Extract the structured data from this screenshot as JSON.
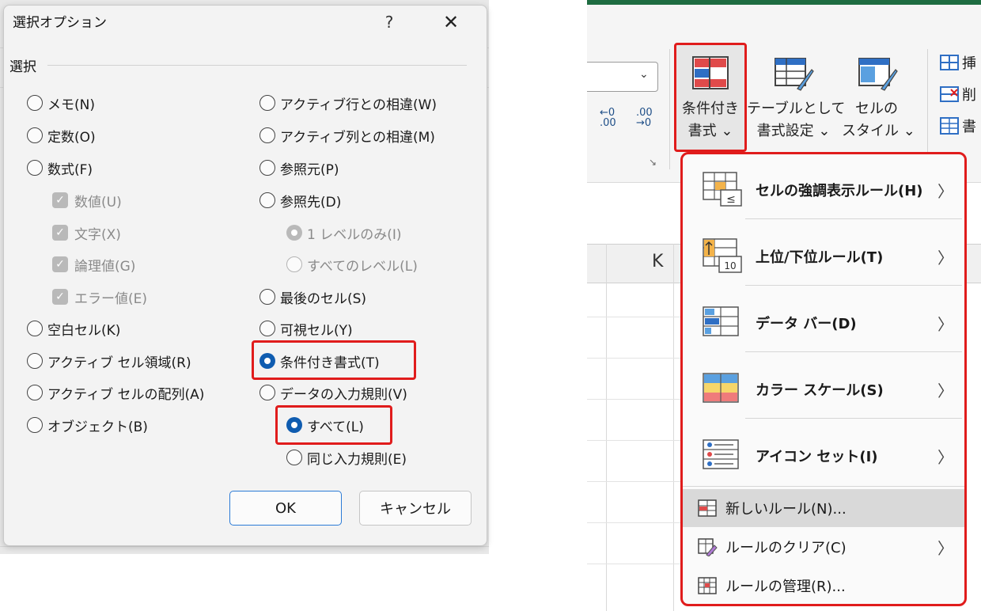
{
  "dialog": {
    "title": "選択オプション",
    "help": "?",
    "close": "✕",
    "group_label": "選択",
    "left_options": [
      {
        "label": "メモ(N)",
        "state": "off"
      },
      {
        "label": "定数(O)",
        "state": "off"
      },
      {
        "label": "数式(F)",
        "state": "off"
      },
      {
        "label": "数値(U)",
        "state": "disabled-checked"
      },
      {
        "label": "文字(X)",
        "state": "disabled-checked"
      },
      {
        "label": "論理値(G)",
        "state": "disabled-checked"
      },
      {
        "label": "エラー値(E)",
        "state": "disabled-checked"
      },
      {
        "label": "空白セル(K)",
        "state": "off"
      },
      {
        "label": "アクティブ セル領域(R)",
        "state": "off"
      },
      {
        "label": "アクティブ セルの配列(A)",
        "state": "off"
      },
      {
        "label": "オブジェクト(B)",
        "state": "off"
      }
    ],
    "right_options": [
      {
        "label": "アクティブ行との相違(W)",
        "state": "off"
      },
      {
        "label": "アクティブ列との相違(M)",
        "state": "off"
      },
      {
        "label": "参照元(P)",
        "state": "off"
      },
      {
        "label": "参照先(D)",
        "state": "off"
      },
      {
        "label": "1 レベルのみ(I)",
        "state": "disabled-selected"
      },
      {
        "label": "すべてのレベル(L)",
        "state": "disabled"
      },
      {
        "label": "最後のセル(S)",
        "state": "off"
      },
      {
        "label": "可視セル(Y)",
        "state": "off"
      },
      {
        "label": "条件付き書式(T)",
        "state": "selected"
      },
      {
        "label": "データの入力規則(V)",
        "state": "off"
      },
      {
        "label": "すべて(L)",
        "state": "selected"
      },
      {
        "label": "同じ入力規則(E)",
        "state": "off"
      }
    ],
    "ok_label": "OK",
    "cancel_label": "キャンセル"
  },
  "ribbon": {
    "combo_arrow": "⌄",
    "launcher": "↘",
    "conditional_format": {
      "line1": "条件付き",
      "line2": "書式 ⌄"
    },
    "table_format": {
      "line1": "テーブルとして",
      "line2": "書式設定 ⌄"
    },
    "cell_style": {
      "line1": "セルの",
      "line2": "スタイル ⌄"
    },
    "insert_label": "挿",
    "delete_label": "削",
    "format_label": "書",
    "column_header": "K"
  },
  "menu": {
    "items": [
      {
        "label": "セルの強調表示ルール(H)",
        "icon": "highlight-rules-icon"
      },
      {
        "label": "上位/下位ルール(T)",
        "icon": "top-bottom-rules-icon"
      },
      {
        "label": "データ バー(D)",
        "icon": "data-bars-icon"
      },
      {
        "label": "カラー スケール(S)",
        "icon": "color-scales-icon"
      },
      {
        "label": "アイコン セット(I)",
        "icon": "icon-sets-icon"
      }
    ],
    "small_items": [
      {
        "label": "新しいルール(N)...",
        "icon": "new-rule-icon",
        "has_submenu": false
      },
      {
        "label": "ルールのクリア(C)",
        "icon": "clear-rules-icon",
        "has_submenu": true
      },
      {
        "label": "ルールの管理(R)...",
        "icon": "manage-rules-icon",
        "has_submenu": false
      }
    ],
    "chevron": "〉",
    "accent": "#e01c1c"
  }
}
